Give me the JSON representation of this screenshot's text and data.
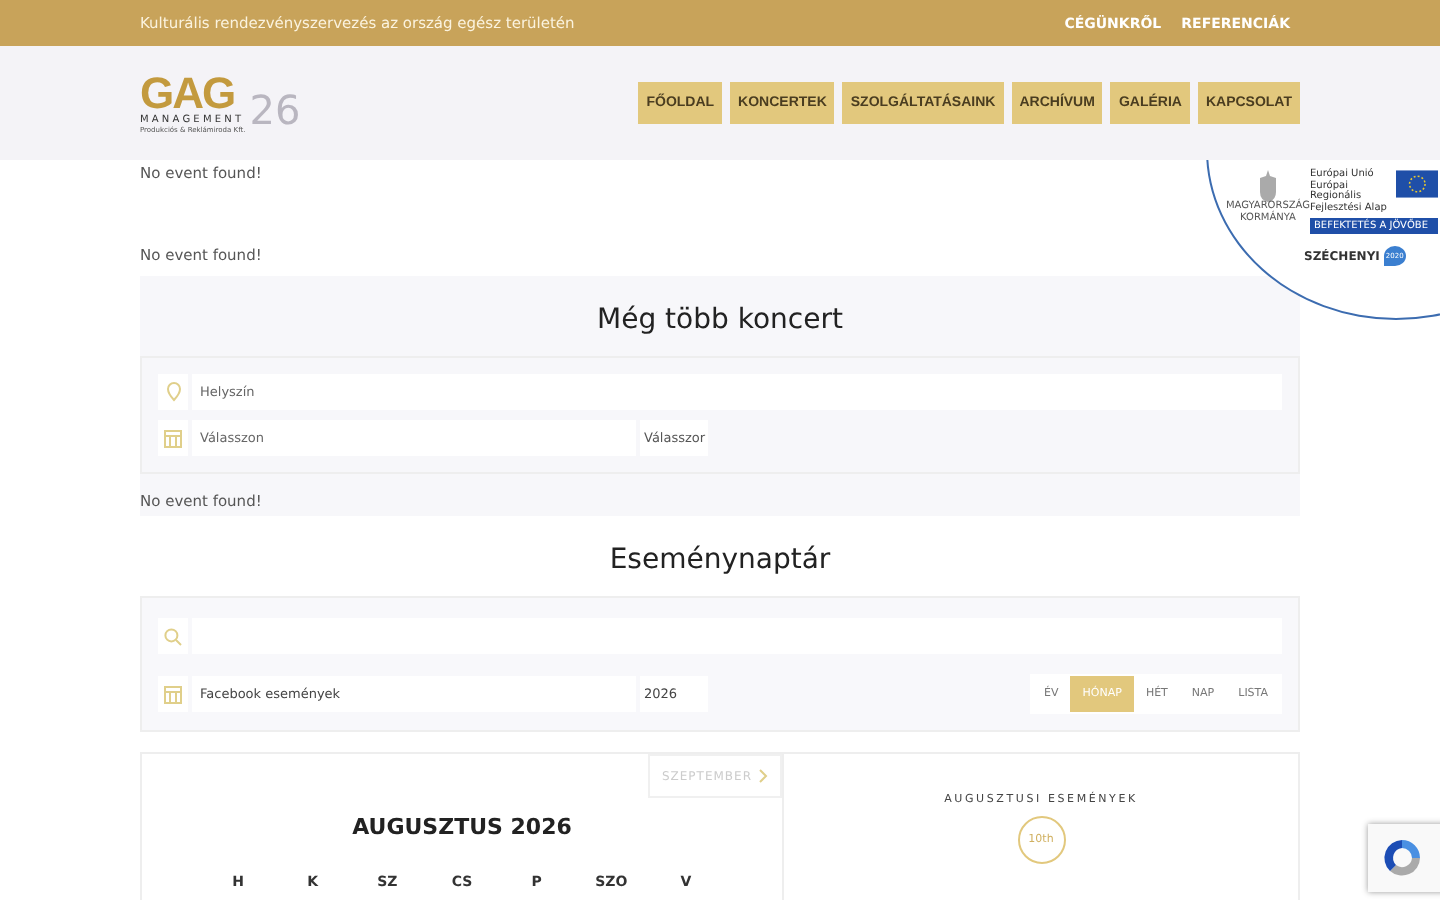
{
  "top_bar": {
    "tagline": "Kulturális rendezvényszervezés az ország egész területén",
    "links": [
      "CÉGÜNKRŐL",
      "REFERENCIÁK"
    ]
  },
  "header": {
    "logo": {
      "letters": "GAG",
      "line1": "MANAGEMENT",
      "line2": "Produkciós & Reklámiroda Kft.",
      "year": "26"
    },
    "nav": [
      "FŐOLDAL",
      "KONCERTEK",
      "SZOLGÁLTATÁSAINK",
      "ARCHÍVUM",
      "GALÉRIA",
      "KAPCSOLAT"
    ]
  },
  "funding_badge": {
    "eu_text": "Európai Unió Európai Regionális Fejlesztési Alap",
    "slogan": "BEFEKTETÉS A JÖVŐBE",
    "gov_text": "MAGYARORSZÁG KORMÁNYA",
    "program": "SZÉCHENYI",
    "program_year": "2020"
  },
  "notices": [
    "No event found!",
    "No event found!"
  ],
  "more_concerts": {
    "title": "Még több koncert",
    "location_placeholder": "Helyszín",
    "date_placeholder": "Válasszon",
    "date_select": "Válasszor",
    "notice": "No event found!"
  },
  "calendar": {
    "title": "Eseménynaptár",
    "source": "Facebook események",
    "year": "2026",
    "views": [
      {
        "label": "ÉV",
        "selected": false
      },
      {
        "label": "HÓNAP",
        "selected": true
      },
      {
        "label": "HÉT",
        "selected": false
      },
      {
        "label": "NAP",
        "selected": false
      },
      {
        "label": "LISTA",
        "selected": false
      }
    ],
    "next_month": "SZEPTEMBER",
    "month_title": "AUGUSZTUS 2026",
    "weekdays": [
      "H",
      "K",
      "SZ",
      "CS",
      "P",
      "SZO",
      "V"
    ],
    "events_title": "AUGUSZTUSI ESEMÉNYEK",
    "event_day": "10th"
  }
}
